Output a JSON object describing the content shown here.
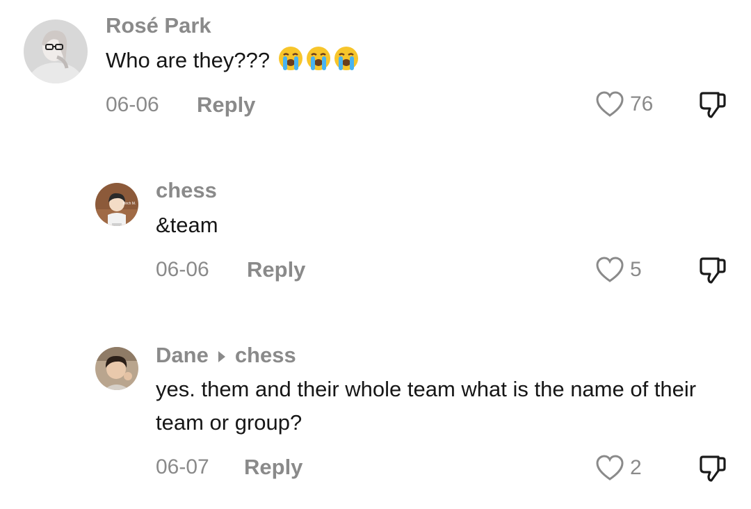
{
  "comments": [
    {
      "username": "Rosé Park",
      "text": "Who are they??? ",
      "date": "06-06",
      "reply_label": "Reply",
      "likes": "76",
      "emojis": [
        "loudly-crying-face",
        "loudly-crying-face",
        "loudly-crying-face"
      ]
    },
    {
      "username": "chess",
      "text": "&team",
      "date": "06-06",
      "reply_label": "Reply",
      "likes": "5",
      "avatar_caption": "Birch M."
    },
    {
      "username": "Dane",
      "reply_to": "chess",
      "text": "yes. them and their whole team what is the name of their team or group?",
      "date": "06-07",
      "reply_label": "Reply",
      "likes": "2"
    }
  ],
  "colors": {
    "muted_text": "#8a8a8a",
    "body_text": "#161616",
    "background": "#ffffff"
  }
}
